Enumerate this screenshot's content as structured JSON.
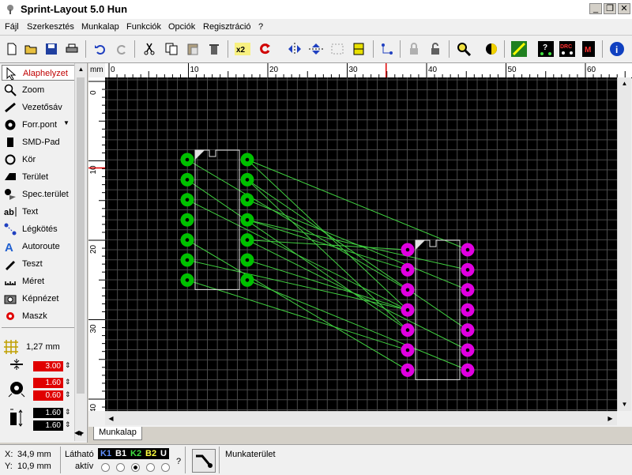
{
  "window": {
    "title": "Sprint-Layout 5.0 Hun"
  },
  "menu": [
    "Fájl",
    "Szerkesztés",
    "Munkalap",
    "Funkciók",
    "Opciók",
    "Regisztráció",
    "?"
  ],
  "toolbar_icons": [
    "new-file-icon",
    "open-folder-icon",
    "save-icon",
    "print-icon",
    "undo-icon",
    "redo-icon",
    "cut-icon",
    "copy-icon",
    "paste-icon",
    "delete-icon",
    "x2-icon",
    "rotate-icon",
    "mirror-horizontal-icon",
    "mirror-vertical-icon",
    "group-icon",
    "align-icon",
    "connections-icon",
    "lock-icon",
    "unlock-icon",
    "zoom-icon",
    "contrast-icon",
    "component-icon",
    "test-icon",
    "drc-icon",
    "macro-icon",
    "info-icon"
  ],
  "tools": [
    {
      "label": "Alaphelyzet",
      "icon": "pointer-icon",
      "active": true
    },
    {
      "label": "Zoom",
      "icon": "magnifier-icon"
    },
    {
      "label": "Vezetősáv",
      "icon": "track-icon"
    },
    {
      "label": "Forr.pont",
      "icon": "pad-icon"
    },
    {
      "label": "SMD-Pad",
      "icon": "smd-pad-icon"
    },
    {
      "label": "Kör",
      "icon": "circle-icon"
    },
    {
      "label": "Terület",
      "icon": "area-icon"
    },
    {
      "label": "Spec.terület",
      "icon": "special-area-icon"
    },
    {
      "label": "Text",
      "icon": "text-icon"
    },
    {
      "label": "Légkötés",
      "icon": "airwire-icon"
    },
    {
      "label": "Autoroute",
      "icon": "autoroute-icon"
    },
    {
      "label": "Teszt",
      "icon": "test-probe-icon"
    },
    {
      "label": "Méret",
      "icon": "measure-icon"
    },
    {
      "label": "Képnézet",
      "icon": "camera-icon"
    },
    {
      "label": "Maszk",
      "icon": "mask-icon"
    }
  ],
  "grid": {
    "value": "1,27 mm"
  },
  "params": {
    "track_width": "3.00",
    "pad_outer": "1.60",
    "pad_inner": "0.60",
    "smd_w": "1.60",
    "smd_h": "1.60"
  },
  "ruler": {
    "unit": "mm",
    "top_labels": [
      "0",
      "10",
      "20",
      "30",
      "40",
      "50",
      "60"
    ],
    "left_labels": [
      "0",
      "10",
      "20",
      "30",
      "40"
    ]
  },
  "components": [
    {
      "name": "DIP-left",
      "pad_color": "#00c000",
      "pins_per_side": 7
    },
    {
      "name": "DIP-right",
      "pad_color": "#e000e0",
      "pins_per_side": 7
    }
  ],
  "tabs": {
    "worksheet": "Munkalap"
  },
  "status": {
    "x_label": "X:",
    "x_value": "34,9 mm",
    "y_label": "Y:",
    "y_value": "10,9 mm",
    "visible_label": "Látható",
    "active_label": "aktív",
    "layers": [
      {
        "name": "K1",
        "color": "#6090ff"
      },
      {
        "name": "B1",
        "color": "#ffffff"
      },
      {
        "name": "K2",
        "color": "#40e040"
      },
      {
        "name": "B2",
        "color": "#ffff40"
      },
      {
        "name": "U",
        "color": "#ffffff"
      }
    ],
    "help_label": "?",
    "workspace_label": "Munkaterület"
  }
}
